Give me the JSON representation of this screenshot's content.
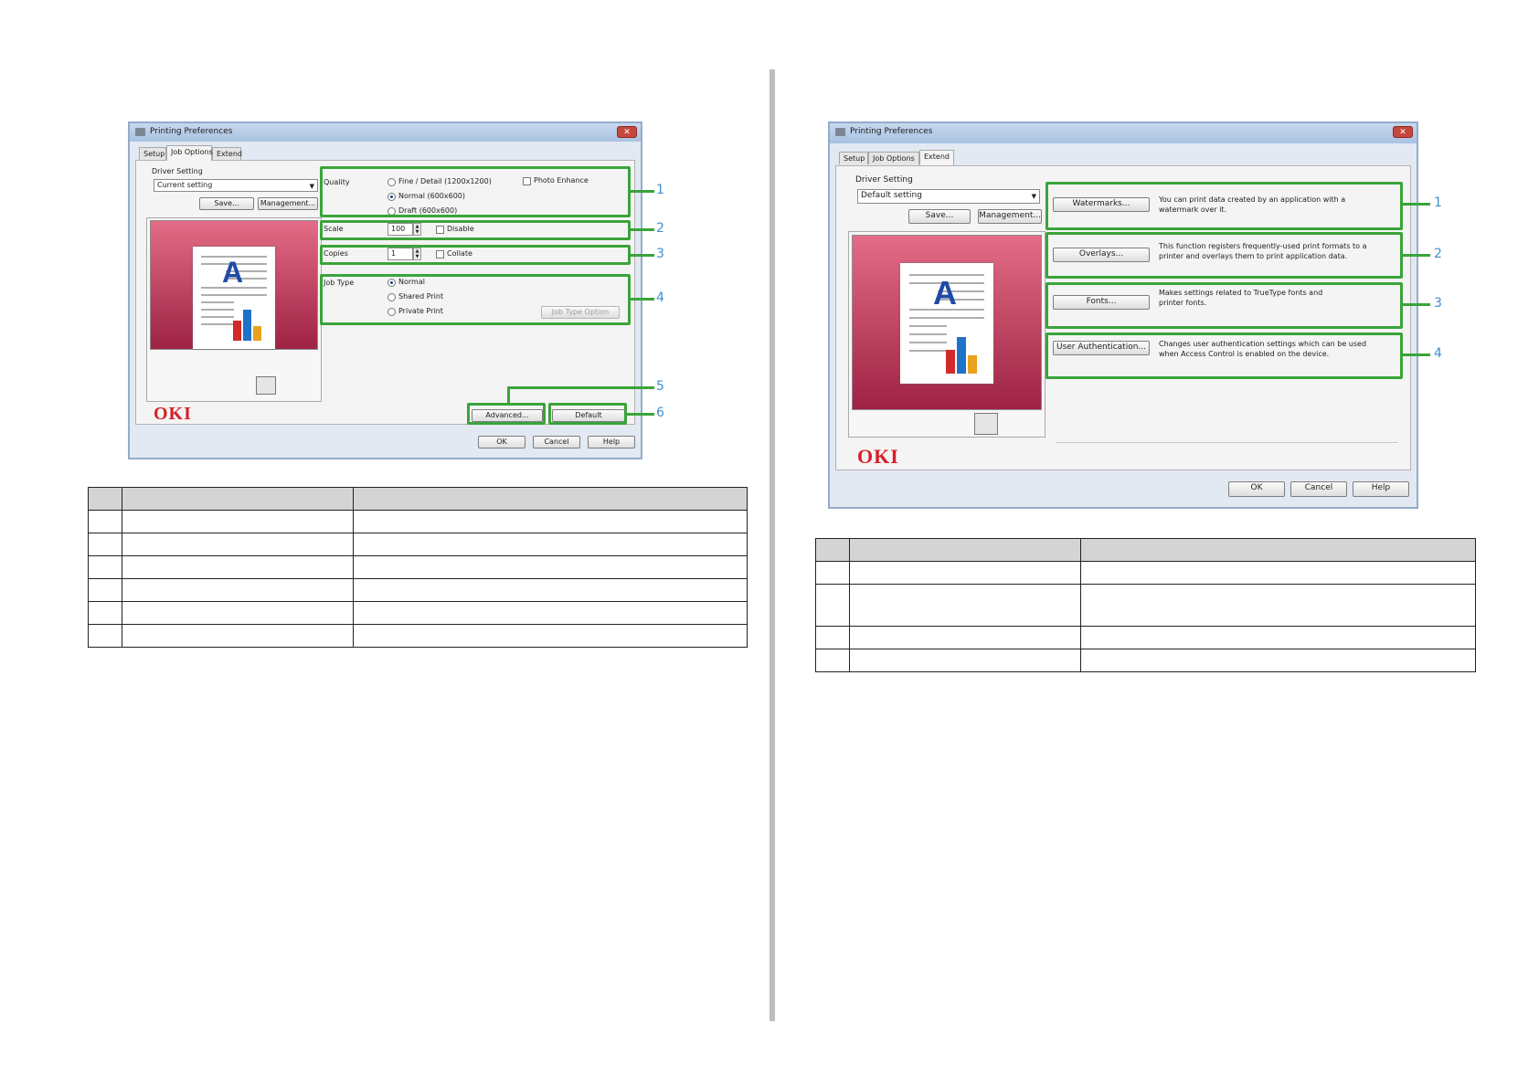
{
  "left_dialog": {
    "title": "Printing Preferences",
    "tabs": [
      "Setup",
      "Job Options",
      "Extend"
    ],
    "driver_setting_label": "Driver Setting",
    "driver_setting_value": "Current setting",
    "save_button": "Save...",
    "management_button": "Management...",
    "quality_label": "Quality",
    "quality_options": [
      "Fine / Detail (1200x1200)",
      "Normal (600x600)",
      "Draft (600x600)"
    ],
    "photo_enhance": "Photo Enhance",
    "scale_label": "Scale",
    "scale_value": "100",
    "disable_label": "Disable",
    "copies_label": "Copies",
    "copies_value": "1",
    "collate_label": "Collate",
    "job_type_label": "Job Type",
    "job_type_options": [
      "Normal",
      "Shared Print",
      "Private Print"
    ],
    "job_type_option_button": "Job Type Option",
    "advanced_button": "Advanced...",
    "default_button": "Default",
    "ok_button": "OK",
    "cancel_button": "Cancel",
    "help_button": "Help",
    "logo": "OKI",
    "preview_letter": "A",
    "callouts": [
      "1",
      "2",
      "3",
      "4",
      "5",
      "6"
    ]
  },
  "right_dialog": {
    "title": "Printing Preferences",
    "tabs": [
      "Setup",
      "Job Options",
      "Extend"
    ],
    "driver_setting_label": "Driver Setting",
    "driver_setting_value": "Default setting",
    "save_button": "Save...",
    "management_button": "Management...",
    "items": [
      {
        "button": "Watermarks...",
        "description": "You can print data created by an application with a watermark over it."
      },
      {
        "button": "Overlays...",
        "description": "This function registers frequently-used print formats to a printer and overlays them to print application data."
      },
      {
        "button": "Fonts...",
        "description": "Makes settings related to TrueType fonts and printer fonts."
      },
      {
        "button": "User Authentication...",
        "description": "Changes user authentication settings which can be used when Access Control is enabled on the device."
      }
    ],
    "ok_button": "OK",
    "cancel_button": "Cancel",
    "help_button": "Help",
    "logo": "OKI",
    "preview_letter": "A",
    "callouts": [
      "1",
      "2",
      "3",
      "4"
    ]
  },
  "colors": {
    "highlight": "#3aa43a",
    "callout_number": "#3c8fd2",
    "logo_red": "#d81f26",
    "table_header": "#d4d4d4"
  }
}
